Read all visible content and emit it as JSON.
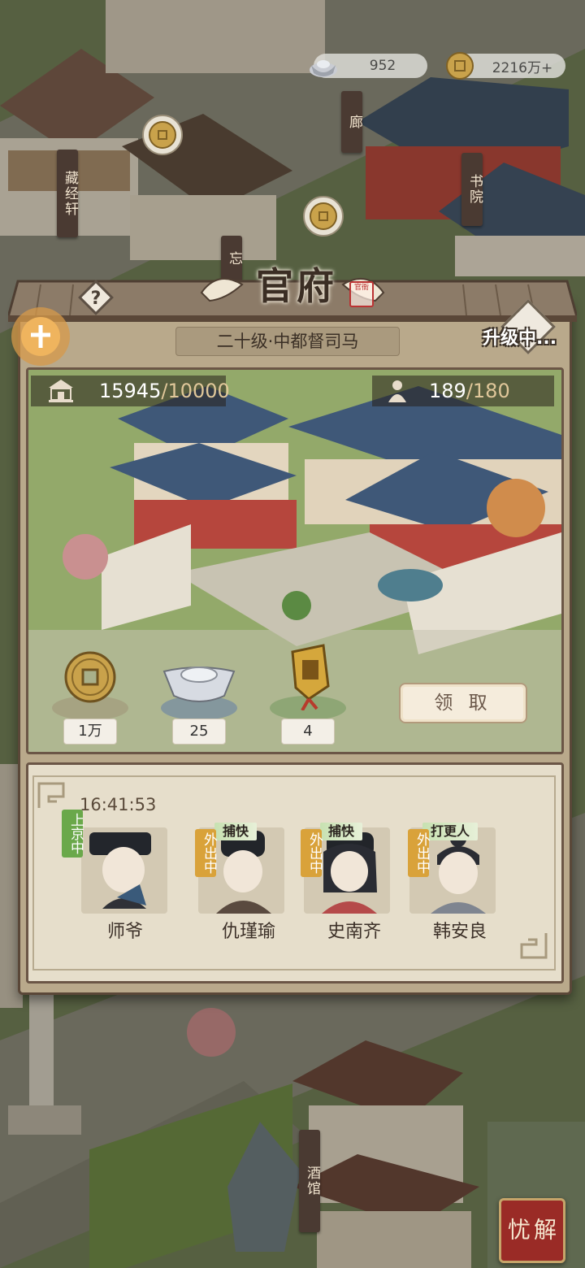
{
  "currency": {
    "silver": "952",
    "coins": "2216万+"
  },
  "map_signs": {
    "cangjingxuan": "藏经轩",
    "lang": "廊",
    "shuyuan": "书院",
    "wang": "忘",
    "jiuguan": "酒馆"
  },
  "panel": {
    "title": "官府",
    "seal": "官衙",
    "level": "二十级·中都督司马",
    "upgrade_status": "升级中...",
    "stats": {
      "prosperity_current": "15945",
      "prosperity_max": "/10000",
      "staff_current": "189",
      "staff_max": "/180"
    },
    "rewards": [
      {
        "icon": "copper-coin-icon",
        "amount": "1万"
      },
      {
        "icon": "silver-ingot-icon",
        "amount": "25"
      },
      {
        "icon": "command-token-icon",
        "amount": "4"
      }
    ],
    "claim_label": "领 取"
  },
  "staff": {
    "timer": "16:41:53",
    "members": [
      {
        "name": "师爷",
        "role": "",
        "status": "上京中",
        "status_color": "#6aa84a"
      },
      {
        "name": "仇瑾瑜",
        "role": "捕快",
        "status": "外出中",
        "status_color": "#d9a23a"
      },
      {
        "name": "史南齐",
        "role": "捕快",
        "status": "外出中",
        "status_color": "#d9a23a"
      },
      {
        "name": "韩安良",
        "role": "打更人",
        "status": "外出中",
        "status_color": "#d9a23a"
      }
    ]
  },
  "corner_button": "解忧",
  "colors": {
    "panel_bg": "#b9a98b",
    "frame": "#5a4738",
    "status_green": "#6aa84a",
    "status_yellow": "#d9a23a"
  }
}
